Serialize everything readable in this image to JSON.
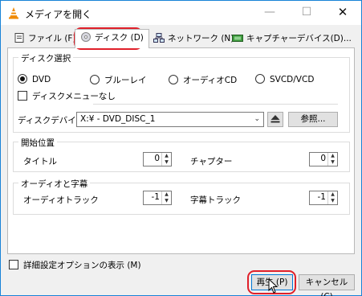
{
  "window": {
    "title": "メディアを開く"
  },
  "title_controls": {
    "minimize": "—",
    "maximize": "☐",
    "close": "✕"
  },
  "tabs": [
    {
      "label": "ファイル (F)",
      "icon": "file-icon"
    },
    {
      "label": "ディスク (D)",
      "icon": "disc-icon",
      "active": true
    },
    {
      "label": "ネットワーク (N)",
      "icon": "network-icon"
    },
    {
      "label": "キャプチャーデバイス(D)...",
      "icon": "capture-device-icon"
    }
  ],
  "disc_select": {
    "title": "ディスク選択",
    "options": [
      {
        "label": "DVD",
        "selected": true
      },
      {
        "label": "ブルーレイ",
        "selected": false
      },
      {
        "label": "オーディオCD",
        "selected": false
      },
      {
        "label": "SVCD/VCD",
        "selected": false
      }
    ],
    "no_menu_label": "ディスクメニューなし",
    "device_label": "ディスクデバイス",
    "device_value": "X:¥ - DVD_DISC_1",
    "browse_label": "参照..."
  },
  "start_position": {
    "title": "開始位置",
    "title_label": "タイトル",
    "title_value": "0",
    "chapter_label": "チャプター",
    "chapter_value": "0"
  },
  "audio_subtitles": {
    "title": "オーディオと字幕",
    "audio_label": "オーディオトラック",
    "audio_value": "-1",
    "subtitle_label": "字幕トラック",
    "subtitle_value": "-1"
  },
  "footer": {
    "show_options_label": "詳細設定オプションの表示 (M)",
    "play_label": "再生 (P)",
    "cancel_label": "キャンセル (C)"
  },
  "colors": {
    "highlight": "#e0202a",
    "accent": "#0078d7"
  }
}
